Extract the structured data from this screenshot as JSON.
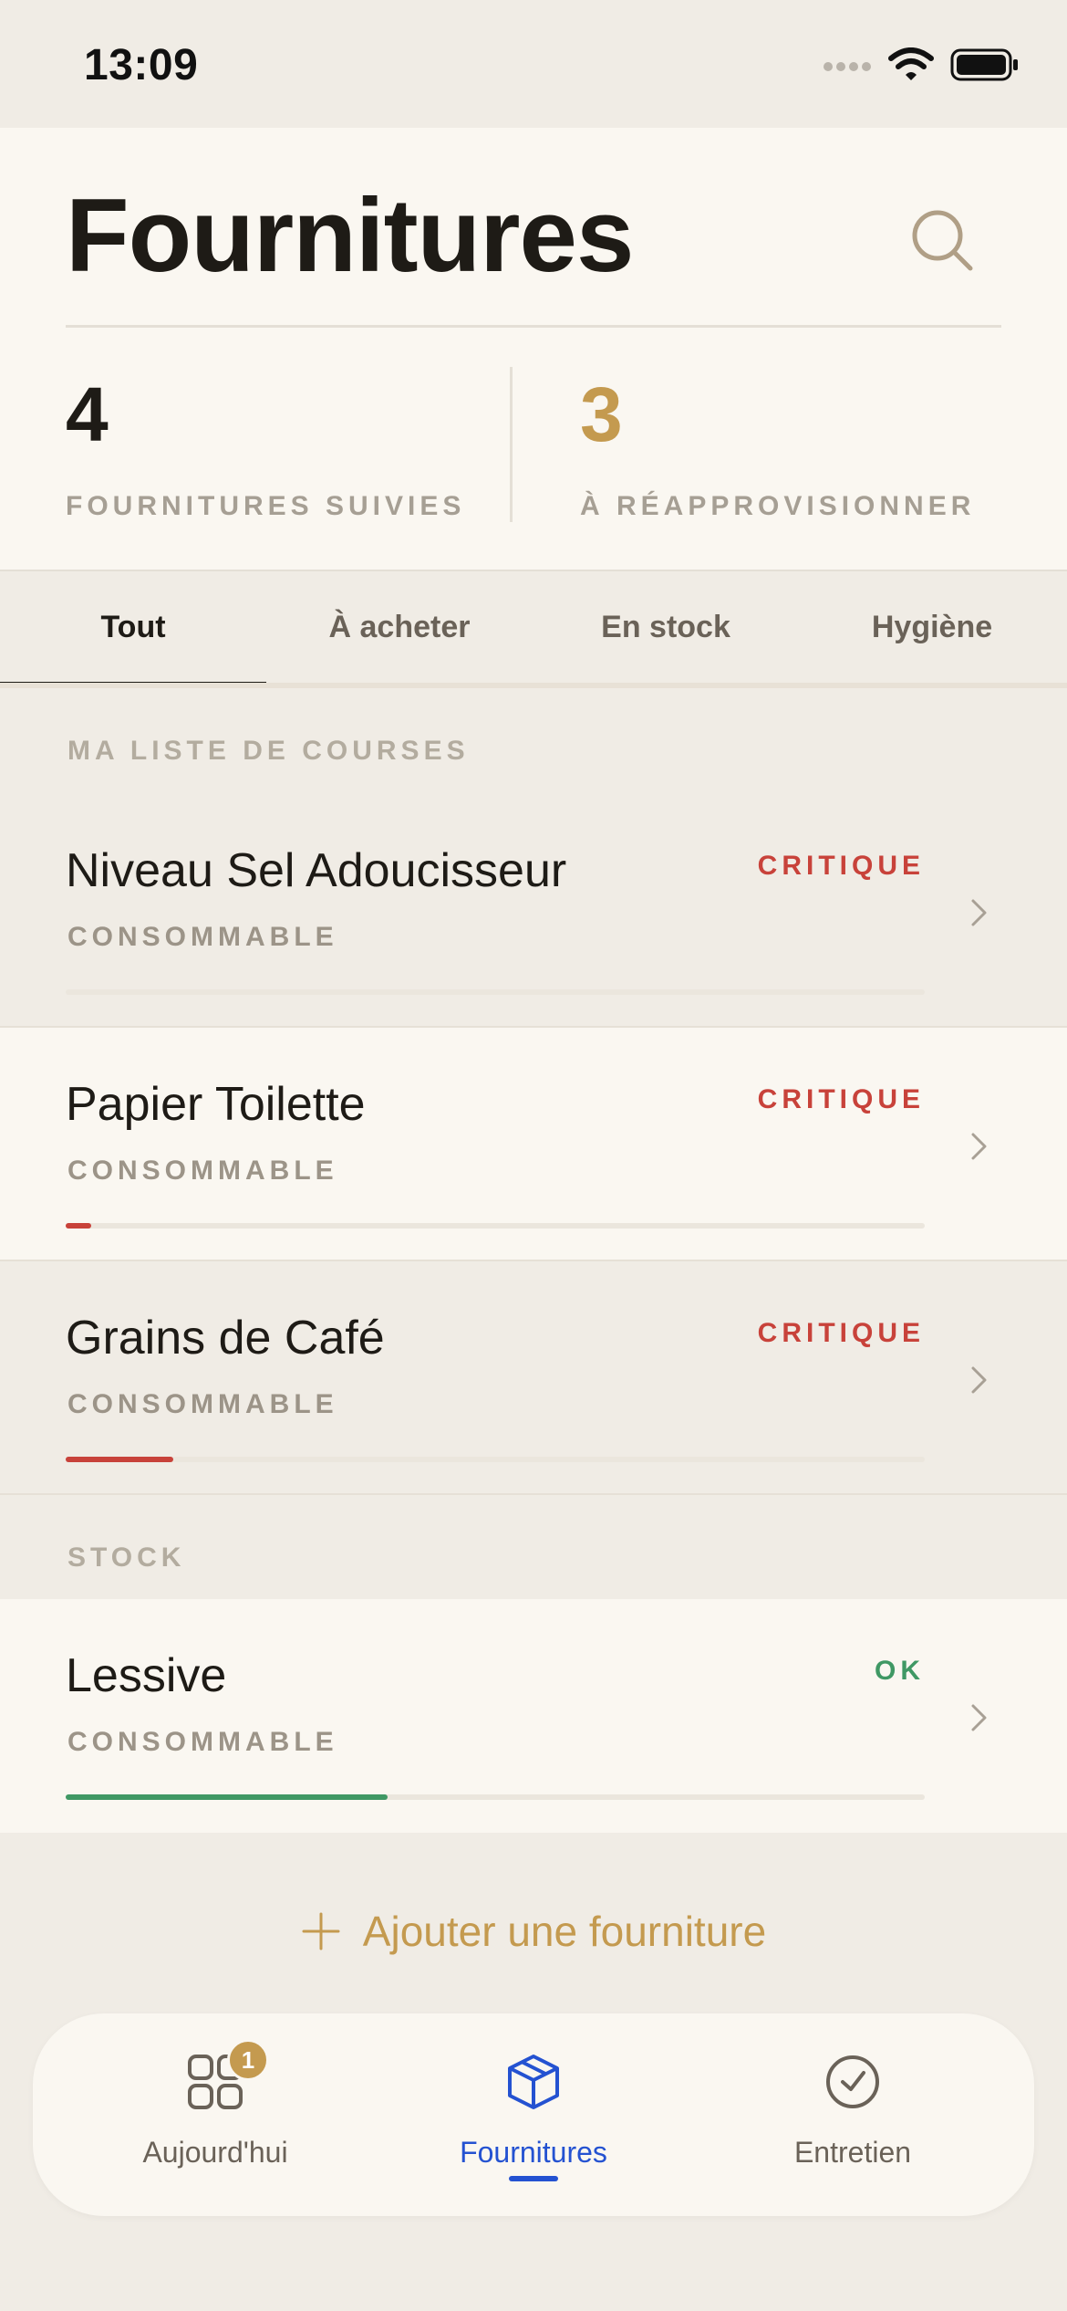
{
  "status_bar": {
    "time": "13:09"
  },
  "header": {
    "title": "Fournitures",
    "stats": [
      {
        "value": "4",
        "label": "FOURNITURES SUIVIES"
      },
      {
        "value": "3",
        "label": "À RÉAPPROVISIONNER"
      }
    ]
  },
  "tabs": [
    {
      "label": "Tout",
      "active": true
    },
    {
      "label": "À acheter",
      "active": false
    },
    {
      "label": "En stock",
      "active": false
    },
    {
      "label": "Hygiène",
      "active": false
    }
  ],
  "sections": {
    "shopping": {
      "label": "MA LISTE DE COURSES",
      "items": [
        {
          "name": "Niveau Sel Adoucisseur",
          "category": "CONSOMMABLE",
          "status": "CRITIQUE",
          "level": 0.0
        },
        {
          "name": "Papier Toilette",
          "category": "CONSOMMABLE",
          "status": "CRITIQUE",
          "level": 0.03
        },
        {
          "name": "Grains de Café",
          "category": "CONSOMMABLE",
          "status": "CRITIQUE",
          "level": 0.125
        }
      ]
    },
    "stock": {
      "label": "STOCK",
      "items": [
        {
          "name": "Lessive",
          "category": "CONSOMMABLE",
          "status": "OK",
          "level": 0.375
        }
      ]
    }
  },
  "add_button": {
    "label": "Ajouter une fourniture"
  },
  "bottom_nav": {
    "items": [
      {
        "label": "Aujourd'hui",
        "icon": "grid-icon",
        "badge": "1",
        "active": false
      },
      {
        "label": "Fournitures",
        "icon": "box-icon",
        "active": true
      },
      {
        "label": "Entretien",
        "icon": "clock-check-icon",
        "active": false
      }
    ]
  },
  "colors": {
    "accent": "#c49a4f",
    "critical": "#c8423a",
    "ok": "#3f9864",
    "nav_active": "#2452d1"
  }
}
